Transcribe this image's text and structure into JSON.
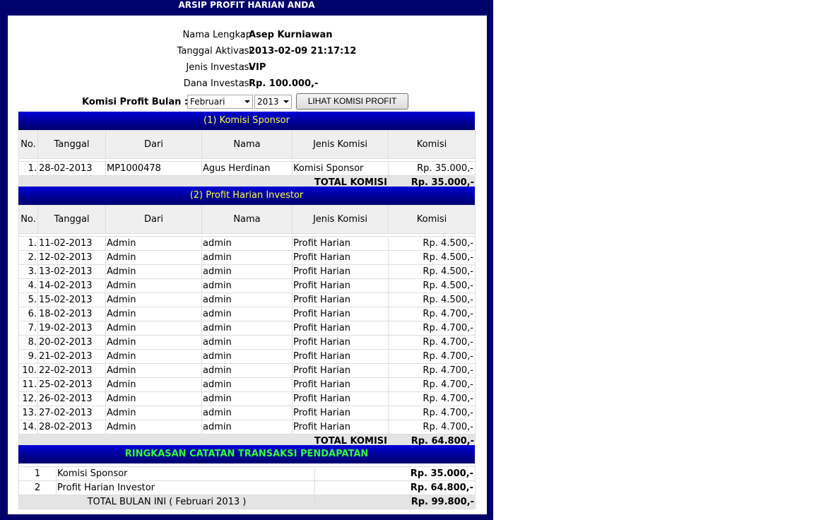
{
  "window_title": "ARSIP PROFIT HARIAN ANDA",
  "info": [
    {
      "label": "Nama Lengkap",
      "value": "Asep Kurniawan"
    },
    {
      "label": "Tanggal Aktivasi",
      "value": "2013-02-09 21:17:12"
    },
    {
      "label": "Jenis Investasi",
      "value": "VIP"
    },
    {
      "label": "Dana Investasi",
      "value": "Rp. 100.000,-"
    }
  ],
  "filter": {
    "label": "Komisi Profit Bulan :",
    "month": "Februari",
    "year": "2013",
    "button": "LIHAT KOMISI PROFIT"
  },
  "columns": [
    "No.",
    "Tanggal",
    "Dari",
    "Nama",
    "Jenis Komisi",
    "Komisi"
  ],
  "sponsor": {
    "title": "(1) Komisi Sponsor",
    "rows": [
      [
        "1.",
        "28-02-2013",
        "MP1000478",
        "Agus Herdinan",
        "Komisi Sponsor",
        "Rp. 35.000,-"
      ]
    ],
    "total_label": "TOTAL KOMISI",
    "total_value": "Rp. 35.000,-"
  },
  "investor": {
    "title": "(2) Profit Harian Investor",
    "rows": [
      [
        "1.",
        "11-02-2013",
        "Admin",
        "admin",
        "Profit Harian",
        "Rp. 4.500,-"
      ],
      [
        "2.",
        "12-02-2013",
        "Admin",
        "admin",
        "Profit Harian",
        "Rp. 4.500,-"
      ],
      [
        "3.",
        "13-02-2013",
        "Admin",
        "admin",
        "Profit Harian",
        "Rp. 4.500,-"
      ],
      [
        "4.",
        "14-02-2013",
        "Admin",
        "admin",
        "Profit Harian",
        "Rp. 4.500,-"
      ],
      [
        "5.",
        "15-02-2013",
        "Admin",
        "admin",
        "Profit Harian",
        "Rp. 4.500,-"
      ],
      [
        "6.",
        "18-02-2013",
        "Admin",
        "admin",
        "Profit Harian",
        "Rp. 4.700,-"
      ],
      [
        "7.",
        "19-02-2013",
        "Admin",
        "admin",
        "Profit Harian",
        "Rp. 4.700,-"
      ],
      [
        "8.",
        "20-02-2013",
        "Admin",
        "admin",
        "Profit Harian",
        "Rp. 4.700,-"
      ],
      [
        "9.",
        "21-02-2013",
        "Admin",
        "admin",
        "Profit Harian",
        "Rp. 4.700,-"
      ],
      [
        "10.",
        "22-02-2013",
        "Admin",
        "admin",
        "Profit Harian",
        "Rp. 4.700,-"
      ],
      [
        "11.",
        "25-02-2013",
        "Admin",
        "admin",
        "Profit Harian",
        "Rp. 4.700,-"
      ],
      [
        "12.",
        "26-02-2013",
        "Admin",
        "admin",
        "Profit Harian",
        "Rp. 4.700,-"
      ],
      [
        "13.",
        "27-02-2013",
        "Admin",
        "admin",
        "Profit Harian",
        "Rp. 4.700,-"
      ],
      [
        "14.",
        "28-02-2013",
        "Admin",
        "admin",
        "Profit Harian",
        "Rp. 4.700,-"
      ]
    ],
    "total_label": "TOTAL KOMISI",
    "total_value": "Rp. 64.800,-"
  },
  "summary": {
    "title": "RINGKASAN CATATAN TRANSAKSI PENDAPATAN",
    "rows": [
      [
        "1",
        "Komisi Sponsor",
        "Rp. 35.000,-"
      ],
      [
        "2",
        "Profit Harian Investor",
        "Rp. 64.800,-"
      ]
    ],
    "total_label": "TOTAL BULAN INI ( Februari 2013 )",
    "total_value": "Rp. 99.800,-"
  },
  "colors": {
    "frame": "#00006b",
    "band_text": "#ffff40",
    "summary_band_text": "#33ff33"
  }
}
